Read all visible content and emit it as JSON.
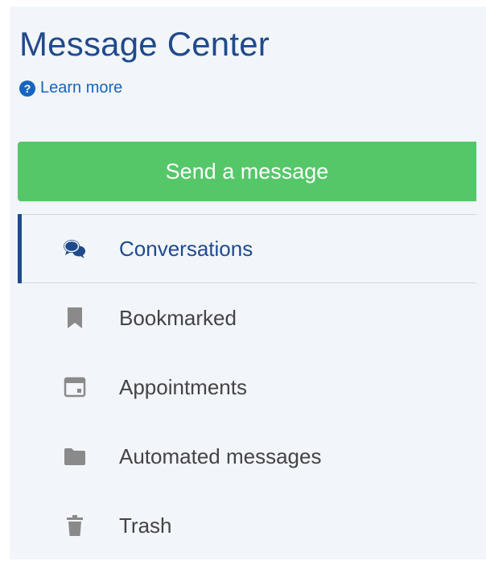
{
  "header": {
    "title": "Message Center",
    "help_icon": "?",
    "learn_more": "Learn more"
  },
  "send_button": {
    "label": "Send a message"
  },
  "nav": {
    "items": [
      {
        "label": "Conversations",
        "icon": "chat-bubbles-icon",
        "active": true
      },
      {
        "label": "Bookmarked",
        "icon": "bookmark-icon"
      },
      {
        "label": "Appointments",
        "icon": "calendar-icon"
      },
      {
        "label": "Automated messages",
        "icon": "folder-icon"
      },
      {
        "label": "Trash",
        "icon": "trash-icon"
      }
    ]
  },
  "colors": {
    "panel_bg": "#f2f6fb",
    "title": "#1f4a8c",
    "link": "#1565c0",
    "send_button": "#55c768",
    "active": "#1f4a8c",
    "icon_gray": "#8a8a8a"
  }
}
